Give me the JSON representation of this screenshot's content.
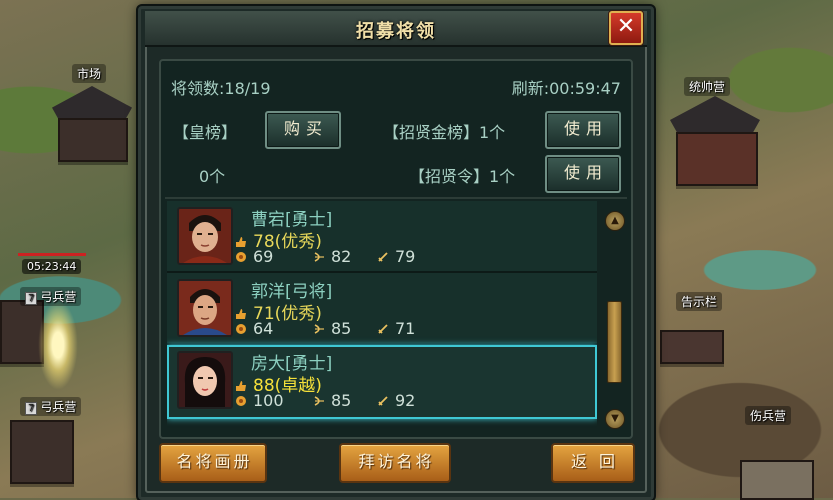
{
  "dialog": {
    "title": "招募将领",
    "close_symbol": "✕",
    "general_count": "将领数:18/19",
    "refresh": "刷新:00:59:47",
    "imperial_list_label": "【皇榜】",
    "buy_label": "购买",
    "imperial_list_count": "0个",
    "gold_list_label": "【招贤金榜】1个",
    "gold_list_use_label": "使用",
    "recruit_order_label": "【招贤令】1个",
    "recruit_order_use_label": "使用"
  },
  "generals": [
    {
      "name": "曹宕[勇士]",
      "rating": "78(优秀)",
      "stat1": "69",
      "stat2": "82",
      "stat3": "79"
    },
    {
      "name": "郭洋[弓将]",
      "rating": "71(优秀)",
      "stat1": "64",
      "stat2": "85",
      "stat3": "71"
    },
    {
      "name": "房大[勇士]",
      "rating": "88(卓越)",
      "stat1": "100",
      "stat2": "85",
      "stat3": "92"
    }
  ],
  "scroll": {
    "up_symbol": "▲",
    "down_symbol": "▼"
  },
  "footer": {
    "album_label": "名将画册",
    "visit_label": "拜访名将",
    "back_label": "返回"
  },
  "map": {
    "market": "市场",
    "commander_camp": "统帅营",
    "timer": "05:23:44",
    "archer_camp_level_1": "7",
    "archer_camp_1": "弓兵营",
    "archer_camp_level_2": "7",
    "archer_camp_2": "弓兵营",
    "notice_board": "告示栏",
    "infirmary": "伤兵营"
  },
  "colors": {
    "selected_border": "#3fc8d4",
    "rating_gold": "#f5e03a",
    "close_red": "#d43a2a"
  }
}
